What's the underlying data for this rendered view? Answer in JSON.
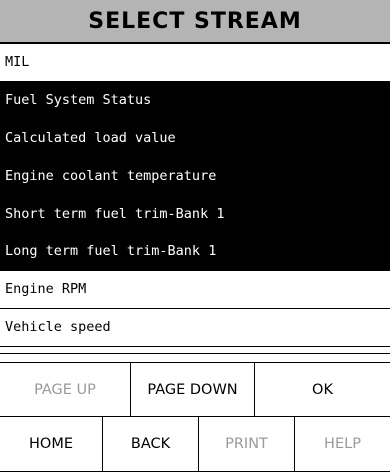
{
  "title": "SELECT STREAM",
  "streams": [
    {
      "label": "MIL",
      "selected": false
    },
    {
      "label": "Fuel System Status",
      "selected": true
    },
    {
      "label": "Calculated load value",
      "selected": true
    },
    {
      "label": "Engine coolant temperature",
      "selected": true
    },
    {
      "label": "Short term fuel trim-Bank 1",
      "selected": true
    },
    {
      "label": "Long term fuel trim-Bank 1",
      "selected": true
    },
    {
      "label": "Engine RPM",
      "selected": false
    },
    {
      "label": "Vehicle speed",
      "selected": false
    }
  ],
  "buttons_row1": [
    {
      "label": "PAGE UP",
      "enabled": false
    },
    {
      "label": "PAGE DOWN",
      "enabled": true
    },
    {
      "label": "OK",
      "enabled": true
    }
  ],
  "buttons_row2": [
    {
      "label": "HOME",
      "enabled": true
    },
    {
      "label": "BACK",
      "enabled": true
    },
    {
      "label": "PRINT",
      "enabled": false
    },
    {
      "label": "HELP",
      "enabled": false
    }
  ],
  "colors": {
    "title_bg": "#b4b4b4",
    "selected_bg": "#000000",
    "selected_fg": "#ffffff",
    "disabled_fg": "#9a9a9a"
  }
}
